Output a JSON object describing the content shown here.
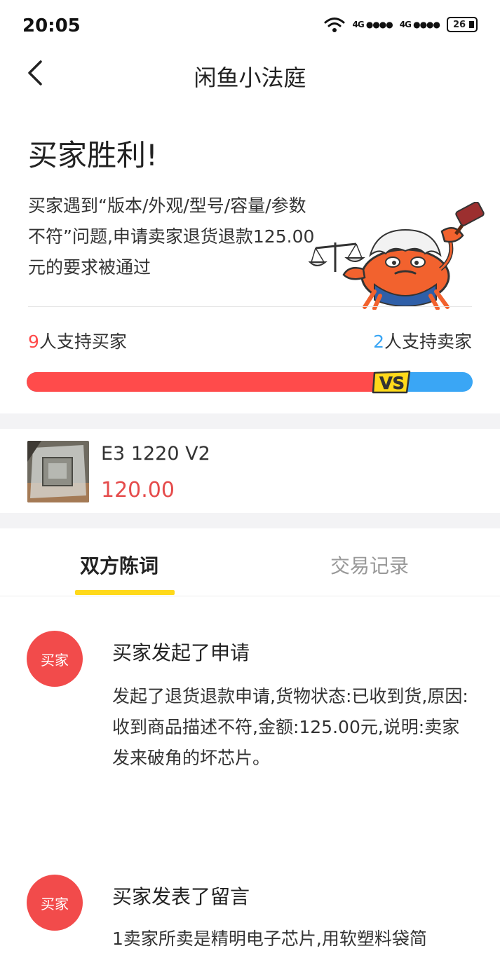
{
  "status_bar": {
    "time": "20:05",
    "signal_1": "4G",
    "signal_2": "4G",
    "battery": "26"
  },
  "nav": {
    "title": "闲鱼小法庭",
    "back_icon": "chevron-left-icon"
  },
  "verdict": {
    "title": "买家胜利!",
    "description": "买家遇到“版本/外观/型号/容量/参数不符”问题,申请卖家退货退款125.00元的要求被通过"
  },
  "support": {
    "buyer_count": "9",
    "buyer_label": "人支持买家",
    "seller_count": "2",
    "seller_label": "人支持卖家",
    "buyer_share": 0.818,
    "vs_label": "VS",
    "buyer_color": "#ff4b4b",
    "seller_color": "#3aa6f5"
  },
  "product": {
    "name": "E3 1220 V2",
    "price": "120.00"
  },
  "tabs": [
    {
      "label": "双方陈词",
      "active": true
    },
    {
      "label": "交易记录",
      "active": false
    }
  ],
  "events": [
    {
      "avatar_label": "买家",
      "title": "买家发起了申请",
      "body": "发起了退货退款申请,货物状态:已收到货,原因:收到商品描述不符,金额:125.00元,说明:卖家发来破角的坏芯片。"
    },
    {
      "avatar_label": "买家",
      "title": "买家发表了留言",
      "body": "1卖家所卖是精明电子芯片,用软塑料袋简"
    }
  ],
  "colors": {
    "accent_yellow": "#ffd91a",
    "price_red": "#e54b4b",
    "avatar_red": "#f24b4b"
  }
}
